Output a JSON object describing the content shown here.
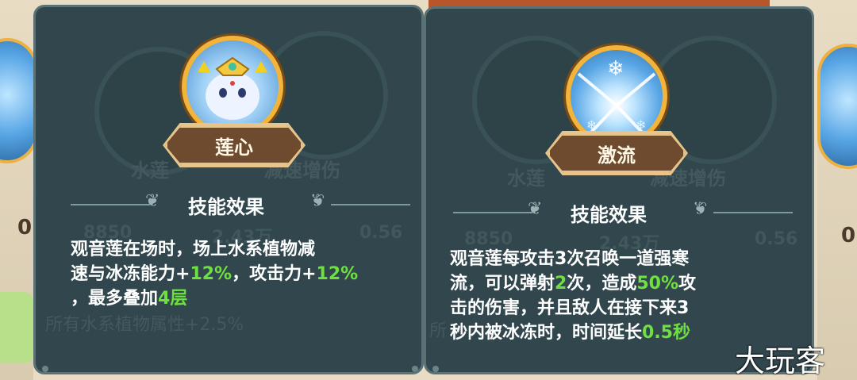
{
  "background": {
    "left_partial_number": "0",
    "left_bottom_text": "所有水系植物属性+2.5%",
    "right_partial_number": "0",
    "right_bottom_text": "所"
  },
  "left_card": {
    "skill_name": "莲心",
    "ghost_labels": [
      "水莲",
      "减速增伤"
    ],
    "ghost_stats": [
      "8850",
      "2.43万",
      "0.56"
    ],
    "section_title": "技能效果",
    "description_lines": [
      [
        {
          "t": "观音莲在场时，场上水系植物减"
        }
      ],
      [
        {
          "t": "速与冰冻能力+"
        },
        {
          "t": "12%",
          "hl": true
        },
        {
          "t": "，攻击力+"
        },
        {
          "t": "12%",
          "hl": true
        }
      ],
      [
        {
          "t": "，最多叠加"
        },
        {
          "t": "4层",
          "hl": true
        }
      ]
    ]
  },
  "right_card": {
    "skill_name": "激流",
    "ghost_labels": [
      "水莲",
      "减速增伤"
    ],
    "ghost_stats": [
      "8850",
      "2.43万",
      "0.56"
    ],
    "section_title": "技能效果",
    "description_lines": [
      [
        {
          "t": "观音莲每攻击3次召唤一道强寒"
        }
      ],
      [
        {
          "t": "流，可以弹射"
        },
        {
          "t": "2",
          "hl": true
        },
        {
          "t": "次，造成"
        },
        {
          "t": "50%",
          "hl": true
        },
        {
          "t": "攻"
        }
      ],
      [
        {
          "t": "击的伤害，并且敌人在接下来3"
        }
      ],
      [
        {
          "t": "秒内被冰冻时，时间延长"
        },
        {
          "t": "0.5秒",
          "hl": true
        }
      ]
    ]
  },
  "watermark": "大玩客",
  "colors": {
    "panel_bg": "#31474d",
    "highlight_green": "#6ee040",
    "plate_brown": "#6e4b2e",
    "icon_gold": "#f2b43a"
  }
}
